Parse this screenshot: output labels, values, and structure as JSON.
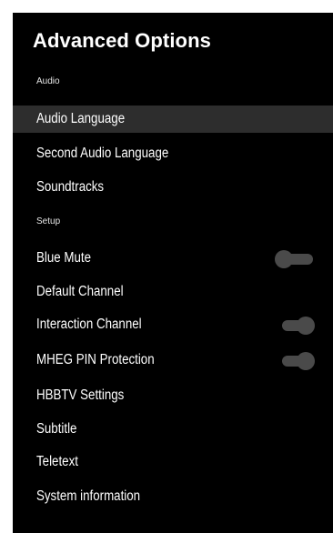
{
  "menu": {
    "title": "Advanced Options",
    "sections": {
      "audio": "Audio",
      "setup": "Setup"
    },
    "items": [
      {
        "label": "Audio Language",
        "selected": true
      },
      {
        "label": "Second Audio Language"
      },
      {
        "label": "Soundtracks"
      },
      {
        "label": "Blue Mute",
        "toggle": "off"
      },
      {
        "label": "Default Channel"
      },
      {
        "label": "Interaction Channel",
        "toggle": "on"
      },
      {
        "label": "MHEG PIN Protection",
        "toggle": "on"
      },
      {
        "label": "HBBTV Settings"
      },
      {
        "label": "Subtitle"
      },
      {
        "label": "Teletext"
      },
      {
        "label": "System information"
      }
    ]
  },
  "colors": {
    "panel_bg": "#000000",
    "selected_row_bg": "#2d2d2d",
    "toggle": "#4a4a4a",
    "text": "#ffffff"
  }
}
